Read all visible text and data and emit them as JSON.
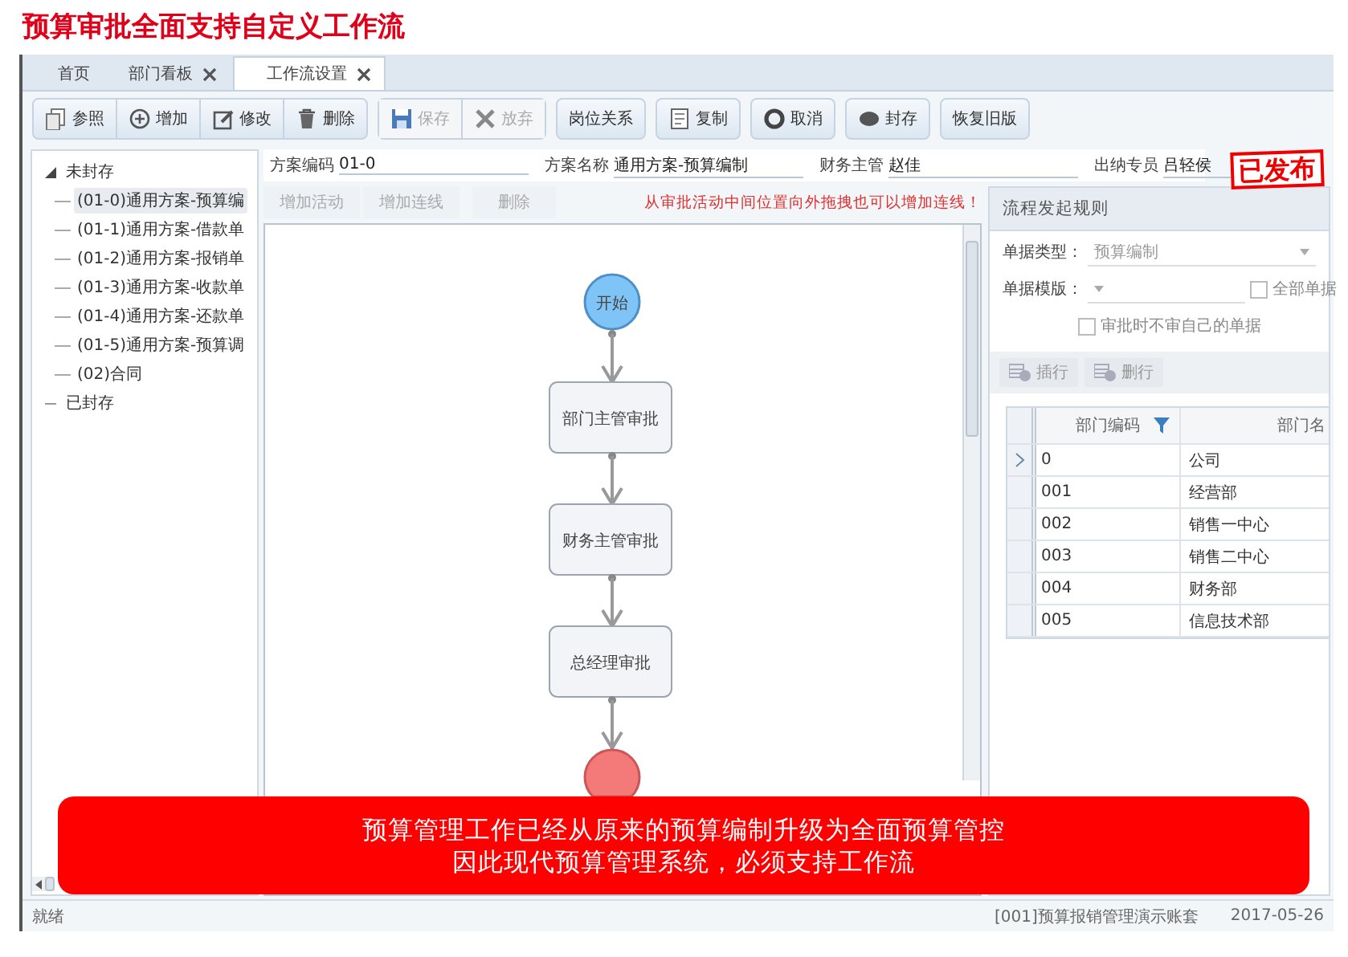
{
  "page_title": "预算审批全面支持自定义工作流",
  "tabs": [
    {
      "label": "首页",
      "selected": false
    },
    {
      "label": "部门看板",
      "selected": false,
      "closable": true
    },
    {
      "label": "工作流设置",
      "selected": true,
      "closable": true
    }
  ],
  "toolbar": [
    {
      "label": "参照",
      "disabled": false
    },
    {
      "label": "增加",
      "disabled": false
    },
    {
      "label": "修改",
      "disabled": false
    },
    {
      "label": "删除",
      "disabled": false
    },
    {
      "label": "保存",
      "disabled": true
    },
    {
      "label": "放弃",
      "disabled": true
    },
    {
      "label": "岗位关系",
      "disabled": false
    },
    {
      "label": "复制",
      "disabled": false
    },
    {
      "label": "取消",
      "disabled": false
    },
    {
      "label": "封存",
      "disabled": false
    },
    {
      "label": "恢复旧版",
      "disabled": false
    }
  ],
  "tree": [
    {
      "label": "未封存",
      "expanded": true,
      "children": [
        {
          "label": "(01-0)通用方案-预算编",
          "selected": true
        },
        {
          "label": "(01-1)通用方案-借款单",
          "selected": false
        },
        {
          "label": "(01-2)通用方案-报销单",
          "selected": false
        },
        {
          "label": "(01-3)通用方案-收款单",
          "selected": false
        },
        {
          "label": "(01-4)通用方案-还款单",
          "selected": false
        },
        {
          "label": "(01-5)通用方案-预算调",
          "selected": false
        },
        {
          "label": "(02)合同",
          "selected": false
        }
      ]
    },
    {
      "label": "已封存",
      "expanded": false
    }
  ],
  "form": [
    {
      "label": "方案编码",
      "value": "01-0"
    },
    {
      "label": "方案名称",
      "value": "通用方案-预算编制"
    },
    {
      "label": "财务主管",
      "value": "赵佳"
    },
    {
      "label": "出纳专员",
      "value": "吕轻侯"
    }
  ],
  "stamp": "已发布",
  "flow_toolbar": [
    {
      "label": "增加活动",
      "disabled": true
    },
    {
      "label": "增加连线",
      "disabled": true
    },
    {
      "label": "删除",
      "disabled": true
    }
  ],
  "flow_hint": "从审批活动中间位置向外拖拽也可以增加连线！",
  "flow_nodes": [
    {
      "kind": "start",
      "label": "开始"
    },
    {
      "kind": "task",
      "label": "部门主管审批"
    },
    {
      "kind": "task",
      "label": "财务主管审批"
    },
    {
      "kind": "task",
      "label": "总经理审批"
    },
    {
      "kind": "end"
    }
  ],
  "rules": {
    "title": "流程发起规则",
    "fields": [
      {
        "label": "单据类型：",
        "value": "预算编制",
        "disabled": true
      },
      {
        "label": "单据模版：",
        "checkbox": {
          "label": "全部单据",
          "checked": false
        }
      }
    ],
    "own_check": {
      "label": "审批时不审自己的单据",
      "checked": false
    },
    "actions": [
      {
        "label": "插行",
        "disabled": true
      },
      {
        "label": "删行",
        "disabled": true
      }
    ],
    "columns": [
      "部门编码",
      "部门名"
    ],
    "rows": [
      {
        "cells": [
          "0",
          "公司"
        ],
        "selected": true
      },
      {
        "cells": [
          "001",
          "经营部"
        ],
        "selected": false
      },
      {
        "cells": [
          "002",
          "销售一中心"
        ],
        "selected": false
      },
      {
        "cells": [
          "003",
          "销售二中心"
        ],
        "selected": false
      },
      {
        "cells": [
          "004",
          "财务部"
        ],
        "selected": false
      },
      {
        "cells": [
          "005",
          "信息技术部"
        ],
        "selected": false
      }
    ]
  },
  "status_bar": {
    "status": "就绪",
    "account": "[001]预算报销管理演示账套",
    "date": "2017-05-26"
  },
  "banner": [
    "预算管理工作已经从原来的预算编制升级为全面预算管控",
    "因此现代预算管理系统，必须支持工作流"
  ]
}
